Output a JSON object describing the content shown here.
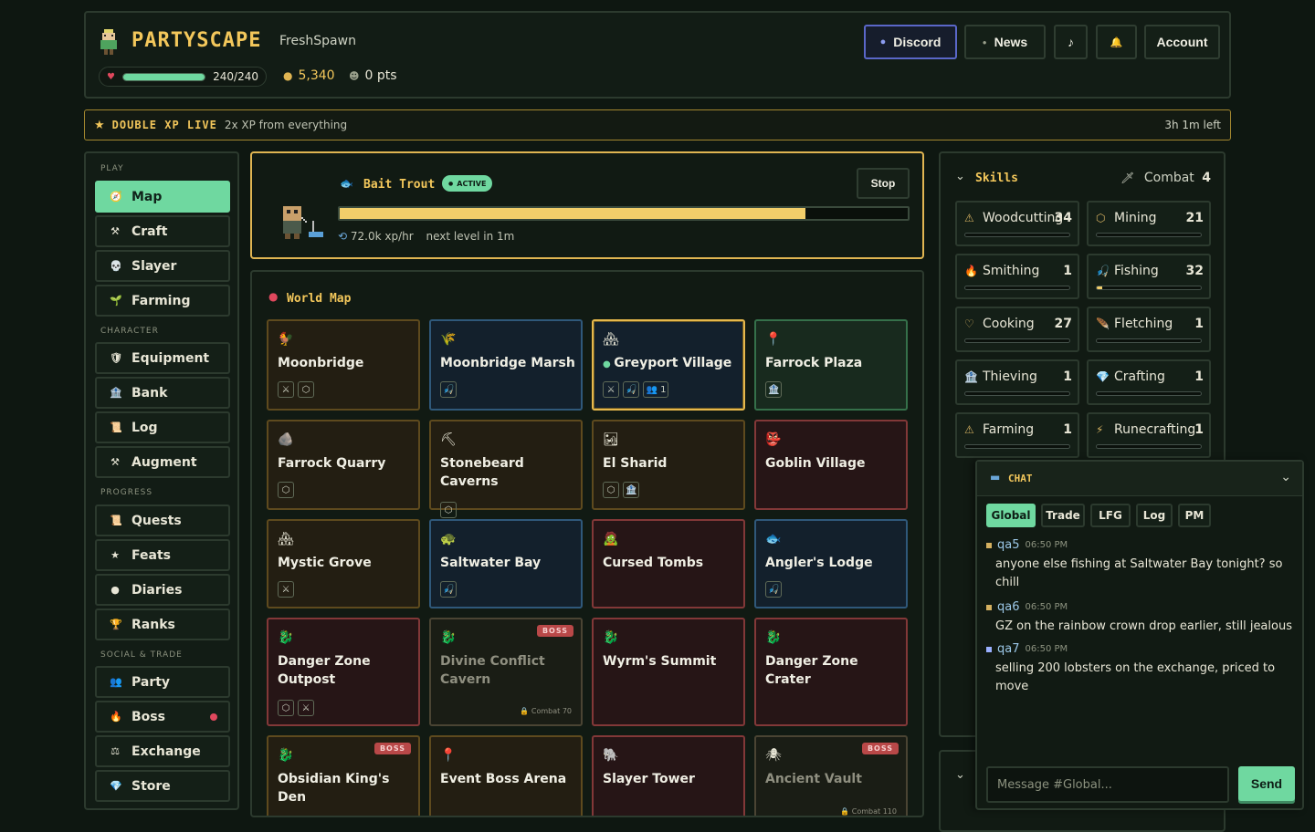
{
  "header": {
    "brand": "PARTYSCAPE",
    "username": "FreshSpawn",
    "hp": "240/240",
    "hp_fraction": 1.0,
    "gold": "5,340",
    "points": "0 pts",
    "buttons": {
      "discord": "Discord",
      "news": "News",
      "music": "♪",
      "bell": "🔔",
      "account": "Account"
    }
  },
  "banner": {
    "title": "DOUBLE XP LIVE",
    "subtitle": "2x XP from everything",
    "time_left": "3h 1m left"
  },
  "sidebar": {
    "sections": [
      {
        "label": "PLAY",
        "items": [
          {
            "label": "Map",
            "icon": "🧭",
            "active": true
          },
          {
            "label": "Craft",
            "icon": "⚒"
          },
          {
            "label": "Slayer",
            "icon": "💀"
          },
          {
            "label": "Farming",
            "icon": "🌱"
          }
        ]
      },
      {
        "label": "CHARACTER",
        "items": [
          {
            "label": "Equipment",
            "icon": "🛡"
          },
          {
            "label": "Bank",
            "icon": "🏦"
          },
          {
            "label": "Log",
            "icon": "📜"
          },
          {
            "label": "Augment",
            "icon": "⚒"
          }
        ]
      },
      {
        "label": "PROGRESS",
        "items": [
          {
            "label": "Quests",
            "icon": "📜"
          },
          {
            "label": "Feats",
            "icon": "★"
          },
          {
            "label": "Diaries",
            "icon": "●"
          },
          {
            "label": "Ranks",
            "icon": "🏆"
          }
        ]
      },
      {
        "label": "SOCIAL & TRADE",
        "items": [
          {
            "label": "Party",
            "icon": "👥"
          },
          {
            "label": "Boss",
            "icon": "🔥",
            "dot": true
          },
          {
            "label": "Exchange",
            "icon": "⚖"
          },
          {
            "label": "Store",
            "icon": "💎"
          }
        ]
      }
    ]
  },
  "activity": {
    "title": "Bait Trout",
    "badge": "ACTIVE",
    "stop": "Stop",
    "progress": 0.82,
    "xp_rate": "72.0k xp/hr",
    "next_level": "next level in 1m"
  },
  "worldmap": {
    "title": "World Map",
    "tiles": [
      {
        "name": "Moonbridge",
        "icon": "🐓",
        "theme": "brown",
        "acts": [
          "⚔",
          "⬡"
        ]
      },
      {
        "name": "Moonbridge Marsh",
        "icon": "🌾",
        "theme": "blue",
        "acts": [
          "🎣"
        ]
      },
      {
        "name": "Greyport Village",
        "icon": "🏘",
        "theme": "blue sel",
        "acts": [
          "⚔",
          "🎣",
          "👥 1"
        ],
        "online": true
      },
      {
        "name": "Farrock Plaza",
        "icon": "📍",
        "theme": "green",
        "acts": [
          "🏦"
        ]
      },
      {
        "name": "Farrock Quarry",
        "icon": "🪨",
        "theme": "brown",
        "acts": [
          "⬡"
        ]
      },
      {
        "name": "Stonebeard Caverns",
        "icon": "⛏",
        "theme": "brown",
        "acts": [
          "⬡"
        ]
      },
      {
        "name": "El Sharid",
        "icon": "🏜",
        "theme": "brown",
        "acts": [
          "⬡",
          "🏦"
        ]
      },
      {
        "name": "Goblin Village",
        "icon": "👺",
        "theme": "red",
        "acts": []
      },
      {
        "name": "Mystic Grove",
        "icon": "🏘",
        "theme": "brown",
        "acts": [
          "⚔"
        ]
      },
      {
        "name": "Saltwater Bay",
        "icon": "🐢",
        "theme": "blue",
        "acts": [
          "🎣"
        ]
      },
      {
        "name": "Cursed Tombs",
        "icon": "🧟",
        "theme": "red",
        "acts": []
      },
      {
        "name": "Angler's Lodge",
        "icon": "🐟",
        "theme": "blue",
        "acts": [
          "🎣"
        ]
      },
      {
        "name": "Danger Zone Outpost",
        "icon": "🐉",
        "theme": "red",
        "acts": [
          "⬡",
          "⚔"
        ]
      },
      {
        "name": "Divine Conflict Cavern",
        "icon": "🐉",
        "theme": "dim",
        "acts": [],
        "boss": "BOSS",
        "req": "🔒 Combat 70"
      },
      {
        "name": "Wyrm's Summit",
        "icon": "🐉",
        "theme": "red",
        "acts": []
      },
      {
        "name": "Danger Zone Crater",
        "icon": "🐉",
        "theme": "red",
        "acts": []
      },
      {
        "name": "Obsidian King's Den",
        "icon": "🐉",
        "theme": "brown",
        "acts": [],
        "boss": "BOSS"
      },
      {
        "name": "Event Boss Arena",
        "icon": "📍",
        "theme": "brown",
        "acts": []
      },
      {
        "name": "Slayer Tower",
        "icon": "🐘",
        "theme": "red",
        "acts": []
      },
      {
        "name": "Ancient Vault",
        "icon": "🕷",
        "theme": "dim",
        "acts": [],
        "boss": "BOSS",
        "req": "🔒 Combat 110"
      }
    ]
  },
  "skills": {
    "title": "Skills",
    "combat_label": "Combat",
    "combat_level": "4",
    "list": [
      {
        "name": "Woodcutting",
        "level": "34",
        "icon": "⚠",
        "progress": 0.0
      },
      {
        "name": "Mining",
        "level": "21",
        "icon": "⬡",
        "progress": 0.0
      },
      {
        "name": "Smithing",
        "level": "1",
        "icon": "🔥",
        "progress": 0.0
      },
      {
        "name": "Fishing",
        "level": "32",
        "icon": "🎣",
        "progress": 0.05
      },
      {
        "name": "Cooking",
        "level": "27",
        "icon": "♡",
        "progress": 0.0
      },
      {
        "name": "Fletching",
        "level": "1",
        "icon": "🪶",
        "progress": 0.0
      },
      {
        "name": "Thieving",
        "level": "1",
        "icon": "🏦",
        "progress": 0.0
      },
      {
        "name": "Crafting",
        "level": "1",
        "icon": "💎",
        "progress": 0.0
      },
      {
        "name": "Farming",
        "level": "1",
        "icon": "⚠",
        "progress": 0.0
      },
      {
        "name": "Runecrafting",
        "level": "1",
        "icon": "⚡",
        "progress": 0.0
      }
    ]
  },
  "chat": {
    "title": "CHAT",
    "tabs": [
      "Global",
      "Trade",
      "LFG",
      "Log",
      "PM"
    ],
    "active_tab": "Global",
    "messages": [
      {
        "user": "qa5",
        "time": "06:50 PM",
        "text": "anyone else fishing at Saltwater Bay tonight? so chill",
        "color": "#d4b060"
      },
      {
        "user": "qa6",
        "time": "06:50 PM",
        "text": "GZ on the rainbow crown drop earlier, still jealous",
        "color": "#d4b060"
      },
      {
        "user": "qa7",
        "time": "06:50 PM",
        "text": "selling 200 lobsters on the exchange, priced to move",
        "color": "#9ab0ff"
      }
    ],
    "input_placeholder": "Message #Global...",
    "send": "Send"
  }
}
